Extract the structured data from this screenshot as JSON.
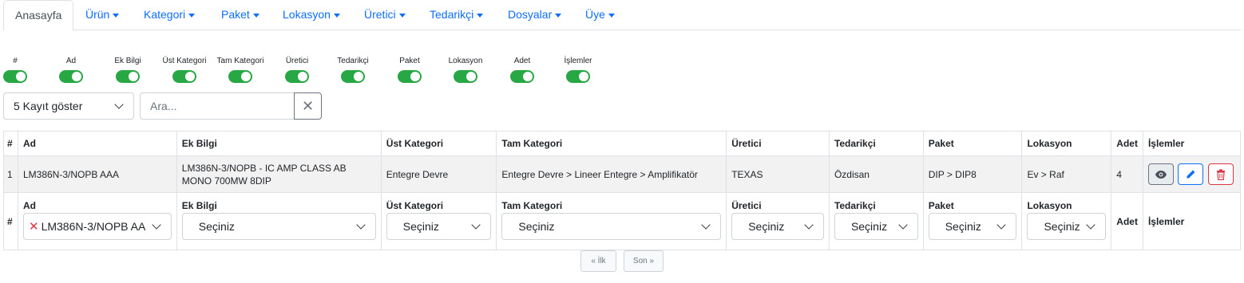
{
  "nav": {
    "home": "Anasayfa",
    "items": [
      "Ürün",
      "Kategori",
      "Paket",
      "Lokasyon",
      "Üretici",
      "Tedarikçi",
      "Dosyalar",
      "Üye"
    ]
  },
  "columns": [
    "#",
    "Ad",
    "Ek Bilgi",
    "Üst Kategori",
    "Tam Kategori",
    "Üretici",
    "Tedarikçi",
    "Paket",
    "Lokasyon",
    "Adet",
    "İşlemler"
  ],
  "column_toggles_on": [
    true,
    true,
    true,
    true,
    true,
    true,
    true,
    true,
    true,
    true,
    true
  ],
  "controls": {
    "page_size": "5 Kayıt göster",
    "search_placeholder": "Ara...",
    "clear_symbol": "✕"
  },
  "rows": [
    {
      "num": "1",
      "ad": "LM386N-3/NOPB AAA",
      "ek_bilgi": "LM386N-3/NOPB - IC AMP CLASS AB MONO 700MW 8DIP",
      "ust_kategori": "Entegre Devre",
      "tam_kategori": "Entegre Devre > Lineer Entegre > Amplifikatör",
      "uretici": "TEXAS",
      "tedarikci": "Özdisan",
      "paket": "DIP > DIP8",
      "lokasyon": "Ev > Raf",
      "adet": "4"
    }
  ],
  "filters": {
    "ad_value": "LM386N-3/NOPB AA",
    "placeholder": "Seçiniz",
    "clear_symbol": "✕"
  },
  "pagination": {
    "first": "« İlk",
    "last": "Son »"
  },
  "colors": {
    "accent": "#0d6efd",
    "toggle_on": "#28a745",
    "danger": "#dc3545"
  }
}
